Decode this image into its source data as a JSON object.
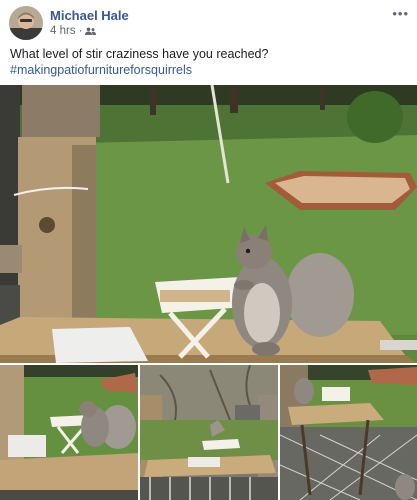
{
  "post": {
    "author": "Michael Hale",
    "timestamp": "4 hrs",
    "audience_icon": "friends-icon",
    "text": "What level of stir craziness have you reached?",
    "hashtag": "#makingpatiofurnitureforsquirrels"
  },
  "header": {
    "more_icon": "more-options-icon"
  },
  "photos": [
    {
      "name": "squirrel-at-tiny-picnic-table"
    },
    {
      "name": "squirrel-closeup"
    },
    {
      "name": "empty-table-setup"
    },
    {
      "name": "squirrel-table-wide"
    }
  ]
}
